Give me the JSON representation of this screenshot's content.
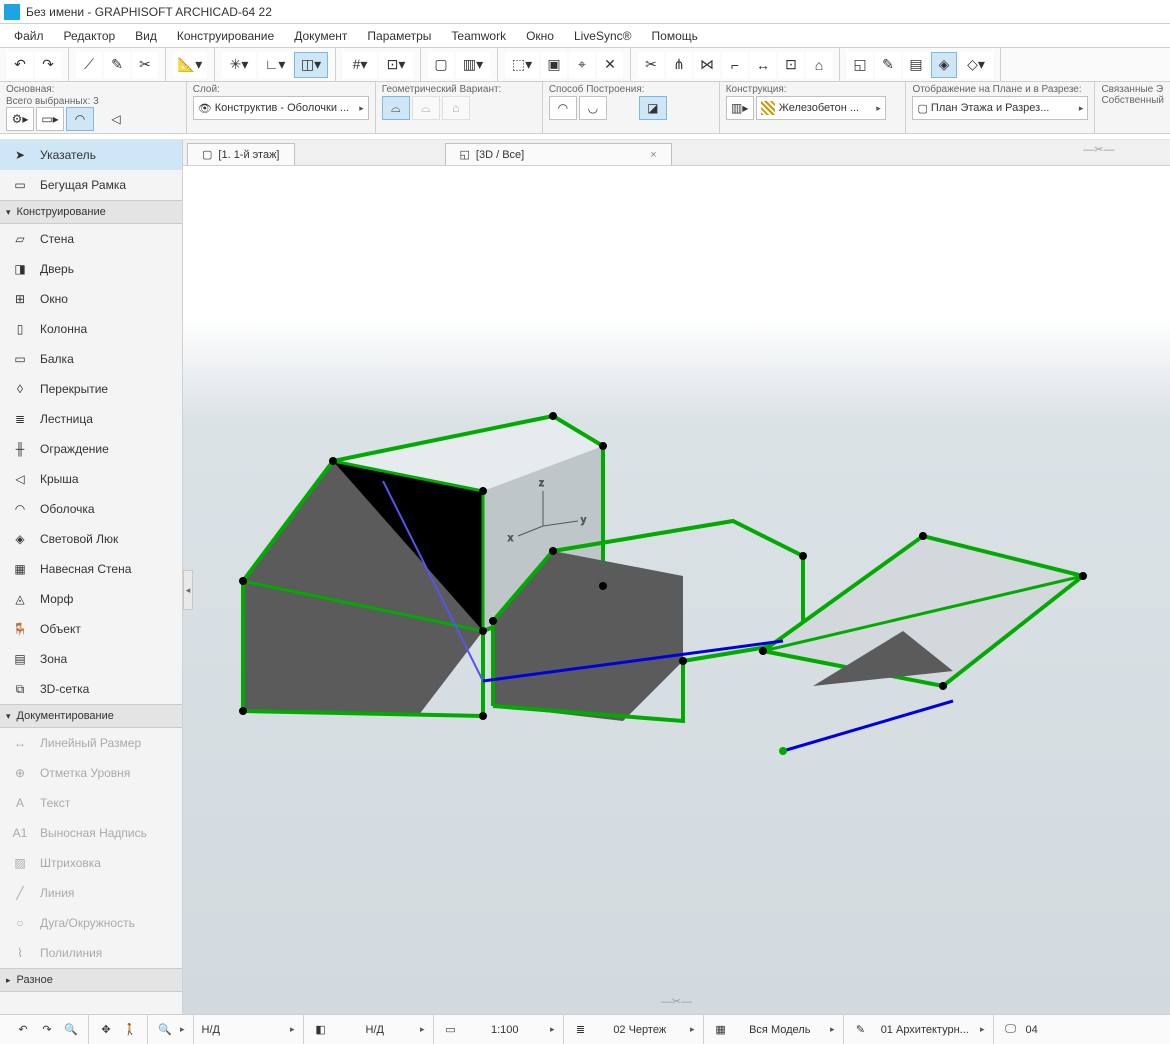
{
  "window": {
    "title": "Без имени - GRAPHISOFT ARCHICAD-64 22"
  },
  "menus": [
    "Файл",
    "Редактор",
    "Вид",
    "Конструирование",
    "Документ",
    "Параметры",
    "Teamwork",
    "Окно",
    "LiveSync®",
    "Помощь"
  ],
  "infobox": {
    "c0label": "Основная:",
    "c0sub": "Всего выбранных: 3",
    "c1label": "Слой:",
    "c1val": "Конструктив - Оболочки ...",
    "c2label": "Геометрический Вариант:",
    "c3label": "Способ Построения:",
    "c4label": "Конструкция:",
    "c4val": "Железобетон ...",
    "c5label": "Отображение на Плане и в Разрезе:",
    "c5val": "План Этажа и Разрез...",
    "c6label": "Связанные Э",
    "c6sub": "Собственный"
  },
  "tabs": {
    "t0": "[1. 1-й этаж]",
    "t1": "[3D / Все]"
  },
  "toolbox": {
    "ptr": "Указатель",
    "marquee": "Бегущая Рамка",
    "hdr1": "Конструирование",
    "wall": "Стена",
    "door": "Дверь",
    "window": "Окно",
    "column": "Колонна",
    "beam": "Балка",
    "slab": "Перекрытие",
    "stair": "Лестница",
    "rail": "Ограждение",
    "roof": "Крыша",
    "shell": "Оболочка",
    "skylight": "Световой Люк",
    "curtain": "Навесная Стена",
    "morph": "Морф",
    "object": "Объект",
    "zone": "Зона",
    "mesh": "3D-сетка",
    "hdr2": "Документирование",
    "dim": "Линейный Размер",
    "level": "Отметка Уровня",
    "text": "Текст",
    "label": "Выносная Надпись",
    "fill": "Штриховка",
    "line": "Линия",
    "arc": "Дуга/Окружность",
    "poly": "Полилиния",
    "hdr3": "Разное"
  },
  "status": {
    "nd1": "Н/Д",
    "nd2": "Н/Д",
    "scale": "1:100",
    "drawing": "02 Чертеж",
    "model": "Вся Модель",
    "arch": "01 Архитектурн...",
    "last": "04"
  }
}
